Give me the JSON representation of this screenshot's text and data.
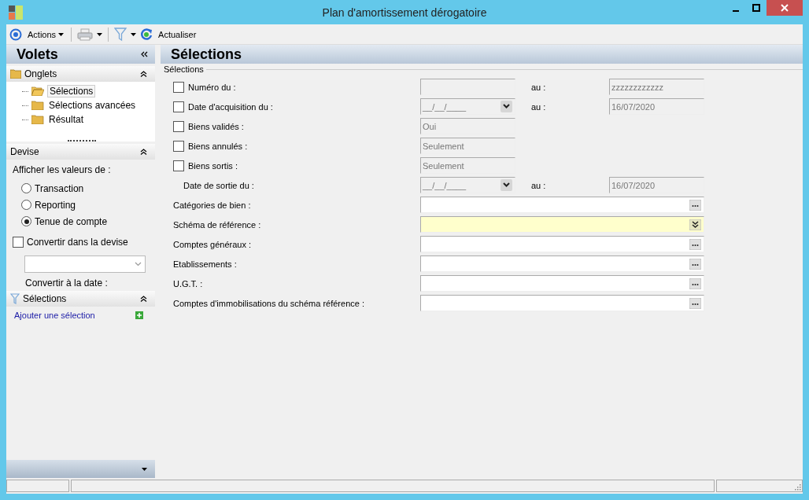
{
  "window": {
    "title": "Plan d'amortissement dérogatoire"
  },
  "toolbar": {
    "actions": "Actions",
    "refresh": "Actualiser"
  },
  "sidebar": {
    "title": "Volets",
    "tabs_section": {
      "title": "Onglets",
      "expanded": true,
      "items": [
        {
          "label": "Sélections",
          "selected": true
        },
        {
          "label": "Sélections avancées",
          "selected": false
        },
        {
          "label": "Résultat",
          "selected": false
        }
      ]
    },
    "currency_section": {
      "title": "Devise",
      "expanded": true,
      "prompt": "Afficher les valeurs de :",
      "options": [
        {
          "label": "Transaction",
          "selected": false
        },
        {
          "label": "Reporting",
          "selected": false
        },
        {
          "label": "Tenue de compte",
          "selected": true
        }
      ],
      "convert": {
        "label": "Convertir dans la devise",
        "checked": false
      },
      "date_label": "Convertir à la date :"
    },
    "selections_section": {
      "title": "Sélections",
      "expanded": true,
      "link": "Ajouter une sélection"
    }
  },
  "main": {
    "title": "Sélections",
    "group": "Sélections",
    "rows": [
      {
        "kind": "range",
        "checked": false,
        "label": "Numéro du :",
        "from": {
          "kind": "text"
        },
        "to_label": "au :",
        "to": {
          "value": "zzzzzzzzzzzz"
        }
      },
      {
        "kind": "range",
        "checked": false,
        "label": "Date d'acquisition du :",
        "from": {
          "kind": "date",
          "value": "__/__/____"
        },
        "to_label": "au :",
        "to": {
          "value": "16/07/2020"
        }
      },
      {
        "kind": "single",
        "checked": false,
        "label": "Biens validés :",
        "from": {
          "kind": "text",
          "value": "Oui"
        }
      },
      {
        "kind": "single",
        "checked": false,
        "label": "Biens annulés :",
        "from": {
          "kind": "text",
          "value": "Seulement"
        }
      },
      {
        "kind": "single",
        "checked": false,
        "label": "Biens sortis :",
        "from": {
          "kind": "text",
          "value": "Seulement"
        }
      },
      {
        "kind": "range",
        "label": "Date de sortie du :",
        "from": {
          "kind": "date",
          "value": "__/__/____"
        },
        "to_label": "au :",
        "to": {
          "value": "16/07/2020"
        }
      },
      {
        "kind": "lookup",
        "label": "Catégories de bien :",
        "button": {
          "kind": "ellipsis"
        },
        "highlighted": false
      },
      {
        "kind": "lookup",
        "label": "Schéma de référence :",
        "button": {
          "kind": "expand"
        },
        "highlighted": true
      },
      {
        "kind": "lookup",
        "label": "Comptes généraux :",
        "button": {
          "kind": "ellipsis"
        },
        "highlighted": false
      },
      {
        "kind": "lookup",
        "label": "Etablissements :",
        "button": {
          "kind": "ellipsis"
        },
        "highlighted": false
      },
      {
        "kind": "lookup",
        "label": "U.G.T. :",
        "button": {
          "kind": "ellipsis"
        },
        "highlighted": false
      },
      {
        "kind": "lookup",
        "label": "Comptes d'immobilisations du schéma référence :",
        "button": {
          "kind": "ellipsis"
        },
        "highlighted": false
      }
    ]
  }
}
